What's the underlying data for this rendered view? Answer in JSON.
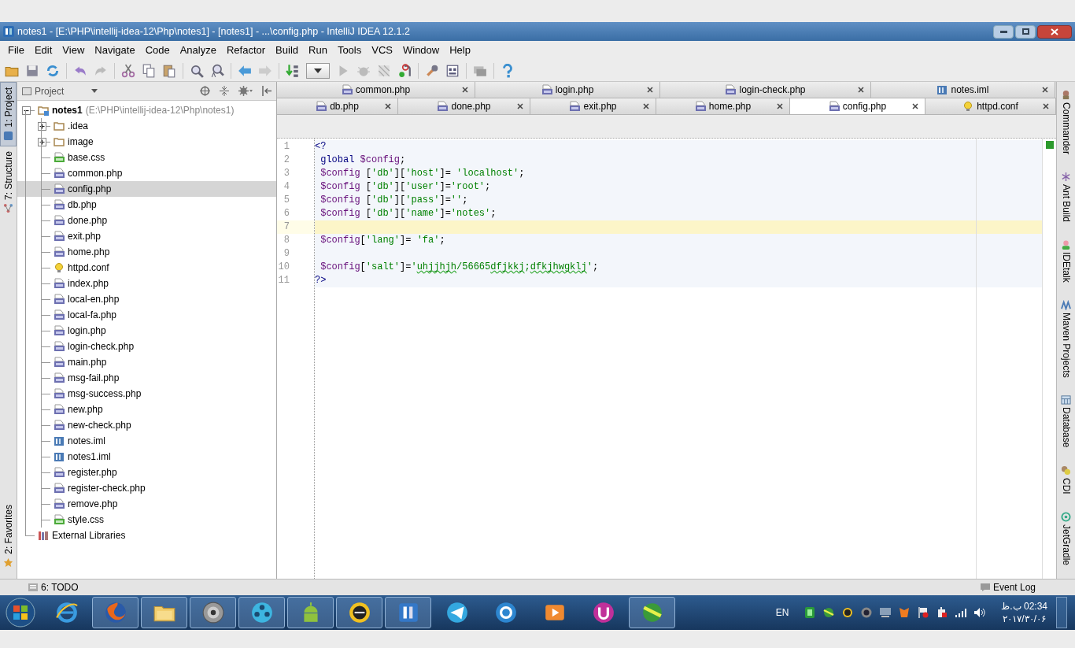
{
  "window": {
    "title": "notes1 - [E:\\PHP\\intellij-idea-12\\Php\\notes1] - [notes1] - ...\\config.php - IntelliJ IDEA 12.1.2"
  },
  "menu": [
    "File",
    "Edit",
    "View",
    "Navigate",
    "Code",
    "Analyze",
    "Refactor",
    "Build",
    "Run",
    "Tools",
    "VCS",
    "Window",
    "Help"
  ],
  "left_tool_tabs": [
    {
      "label": "1: Project",
      "selected": true,
      "kind": "project"
    },
    {
      "label": "7: Structure",
      "selected": false,
      "kind": "structure"
    },
    {
      "label": "2: Favorites",
      "selected": false,
      "kind": "favorites"
    }
  ],
  "project_panel": {
    "view": "Project",
    "tree": [
      {
        "label": "notes1",
        "path": "(E:\\PHP\\intellij-idea-12\\Php\\notes1)",
        "kind": "module",
        "expanded": true,
        "selected": false,
        "children": [
          {
            "label": ".idea",
            "kind": "folder",
            "expanded": false,
            "selected": false
          },
          {
            "label": "image",
            "kind": "folder",
            "expanded": false,
            "selected": false
          },
          {
            "label": "base.css",
            "kind": "css",
            "selected": false
          },
          {
            "label": "common.php",
            "kind": "php",
            "selected": false
          },
          {
            "label": "config.php",
            "kind": "php",
            "selected": true
          },
          {
            "label": "db.php",
            "kind": "php",
            "selected": false
          },
          {
            "label": "done.php",
            "kind": "php",
            "selected": false
          },
          {
            "label": "exit.php",
            "kind": "php",
            "selected": false
          },
          {
            "label": "home.php",
            "kind": "php",
            "selected": false
          },
          {
            "label": "httpd.conf",
            "kind": "conf",
            "selected": false
          },
          {
            "label": "index.php",
            "kind": "php",
            "selected": false
          },
          {
            "label": "local-en.php",
            "kind": "php",
            "selected": false
          },
          {
            "label": "local-fa.php",
            "kind": "php",
            "selected": false
          },
          {
            "label": "login.php",
            "kind": "php",
            "selected": false
          },
          {
            "label": "login-check.php",
            "kind": "php",
            "selected": false
          },
          {
            "label": "main.php",
            "kind": "php",
            "selected": false
          },
          {
            "label": "msg-fail.php",
            "kind": "php",
            "selected": false
          },
          {
            "label": "msg-success.php",
            "kind": "php",
            "selected": false
          },
          {
            "label": "new.php",
            "kind": "php",
            "selected": false
          },
          {
            "label": "new-check.php",
            "kind": "php",
            "selected": false
          },
          {
            "label": "notes.iml",
            "kind": "iml",
            "selected": false
          },
          {
            "label": "notes1.iml",
            "kind": "iml",
            "selected": false
          },
          {
            "label": "register.php",
            "kind": "php",
            "selected": false
          },
          {
            "label": "register-check.php",
            "kind": "php",
            "selected": false
          },
          {
            "label": "remove.php",
            "kind": "php",
            "selected": false
          },
          {
            "label": "style.css",
            "kind": "css",
            "selected": false
          }
        ]
      },
      {
        "label": "External Libraries",
        "kind": "library",
        "selected": false
      }
    ]
  },
  "editor_tabs": [
    [
      {
        "label": "common.php",
        "kind": "php",
        "selected": false
      },
      {
        "label": "login.php",
        "kind": "php",
        "selected": false
      },
      {
        "label": "login-check.php",
        "kind": "php",
        "selected": false
      },
      {
        "label": "notes.iml",
        "kind": "iml",
        "selected": false
      }
    ],
    [
      {
        "label": "db.php",
        "kind": "php",
        "selected": false
      },
      {
        "label": "done.php",
        "kind": "php",
        "selected": false
      },
      {
        "label": "exit.php",
        "kind": "php",
        "selected": false
      },
      {
        "label": "home.php",
        "kind": "php",
        "selected": false
      },
      {
        "label": "config.php",
        "kind": "php",
        "selected": true
      },
      {
        "label": "httpd.conf",
        "kind": "conf",
        "selected": false
      }
    ]
  ],
  "editor": {
    "lines": [
      {
        "number": "1",
        "current": false,
        "tokens": [
          {
            "kind": "tag",
            "text": "<?"
          }
        ]
      },
      {
        "number": "2",
        "current": false,
        "tokens": [
          {
            "kind": "keyword",
            "text": " global "
          },
          {
            "kind": "var",
            "text": "$config"
          },
          {
            "kind": "punct",
            "text": ";"
          }
        ]
      },
      {
        "number": "3",
        "current": false,
        "tokens": [
          {
            "kind": "var",
            "text": " $config "
          },
          {
            "kind": "punct",
            "text": "["
          },
          {
            "kind": "string",
            "text": "'db'"
          },
          {
            "kind": "punct",
            "text": "]["
          },
          {
            "kind": "string",
            "text": "'host'"
          },
          {
            "kind": "punct",
            "text": "]= "
          },
          {
            "kind": "string",
            "text": "'localhost'"
          },
          {
            "kind": "punct",
            "text": ";"
          }
        ]
      },
      {
        "number": "4",
        "current": false,
        "tokens": [
          {
            "kind": "var",
            "text": " $config "
          },
          {
            "kind": "punct",
            "text": "["
          },
          {
            "kind": "string",
            "text": "'db'"
          },
          {
            "kind": "punct",
            "text": "]["
          },
          {
            "kind": "string",
            "text": "'user'"
          },
          {
            "kind": "punct",
            "text": "]="
          },
          {
            "kind": "string",
            "text": "'root'"
          },
          {
            "kind": "punct",
            "text": ";"
          }
        ]
      },
      {
        "number": "5",
        "current": false,
        "tokens": [
          {
            "kind": "var",
            "text": " $config "
          },
          {
            "kind": "punct",
            "text": "["
          },
          {
            "kind": "string",
            "text": "'db'"
          },
          {
            "kind": "punct",
            "text": "]["
          },
          {
            "kind": "string",
            "text": "'pass'"
          },
          {
            "kind": "punct",
            "text": "]="
          },
          {
            "kind": "string",
            "text": "''"
          },
          {
            "kind": "punct",
            "text": ";"
          }
        ]
      },
      {
        "number": "6",
        "current": false,
        "tokens": [
          {
            "kind": "var",
            "text": " $config "
          },
          {
            "kind": "punct",
            "text": "["
          },
          {
            "kind": "string",
            "text": "'db'"
          },
          {
            "kind": "punct",
            "text": "]["
          },
          {
            "kind": "string",
            "text": "'name'"
          },
          {
            "kind": "punct",
            "text": "]="
          },
          {
            "kind": "string",
            "text": "'notes'"
          },
          {
            "kind": "punct",
            "text": ";"
          }
        ]
      },
      {
        "number": "7",
        "current": true
      },
      {
        "number": "8",
        "current": false,
        "tokens": [
          {
            "kind": "var",
            "text": " $config"
          },
          {
            "kind": "punct",
            "text": "["
          },
          {
            "kind": "string",
            "text": "'lang'"
          },
          {
            "kind": "punct",
            "text": "]= "
          },
          {
            "kind": "string",
            "text": "'fa'"
          },
          {
            "kind": "punct",
            "text": ";"
          }
        ]
      },
      {
        "number": "9",
        "current": false
      },
      {
        "number": "10",
        "current": false,
        "tokens": [
          {
            "kind": "var",
            "text": " $config"
          },
          {
            "kind": "punct",
            "text": "["
          },
          {
            "kind": "string",
            "text": "'salt'"
          },
          {
            "kind": "punct",
            "text": "]="
          },
          {
            "kind": "string",
            "text": "'"
          },
          {
            "kind": "typo",
            "text": "uhjjhjh"
          },
          {
            "kind": "string",
            "text": "/56665"
          },
          {
            "kind": "typo",
            "text": "dfjkkj"
          },
          {
            "kind": "string",
            "text": ";"
          },
          {
            "kind": "typo",
            "text": "dfkjhwgklj"
          },
          {
            "kind": "string",
            "text": "'"
          },
          {
            "kind": "punct",
            "text": ";"
          }
        ]
      },
      {
        "number": "11",
        "current": false,
        "tokens": [
          {
            "kind": "tag",
            "text": "?>"
          }
        ]
      }
    ]
  },
  "right_tool_tabs": [
    {
      "label": "Commander",
      "kind": "commander"
    },
    {
      "label": "Ant Build",
      "kind": "ant"
    },
    {
      "label": "IDEtalk",
      "kind": "talk"
    },
    {
      "label": "Maven Projects",
      "kind": "maven"
    },
    {
      "label": "Database",
      "kind": "database"
    },
    {
      "label": "CDI",
      "kind": "cdi"
    },
    {
      "label": "JetGradle",
      "kind": "gradle"
    }
  ],
  "bottom_bar": {
    "left": "6: TODO",
    "right": "Event Log"
  },
  "taskbar": {
    "apps": [
      {
        "kind": "ie",
        "running": false
      },
      {
        "kind": "firefox",
        "running": true
      },
      {
        "kind": "explorer",
        "running": true
      },
      {
        "kind": "disc",
        "running": true
      },
      {
        "kind": "film",
        "running": true
      },
      {
        "kind": "android",
        "running": true
      },
      {
        "kind": "helmet",
        "running": true
      },
      {
        "kind": "idea",
        "running": true
      },
      {
        "kind": "telegram",
        "running": false
      },
      {
        "kind": "sync",
        "running": false
      },
      {
        "kind": "player",
        "running": false
      },
      {
        "kind": "uninstall",
        "running": false
      },
      {
        "kind": "download",
        "running": true
      }
    ],
    "language": "EN",
    "time": "02:34 ب.ظ",
    "date": "۲۰۱۷/۳۰/۰۶"
  }
}
